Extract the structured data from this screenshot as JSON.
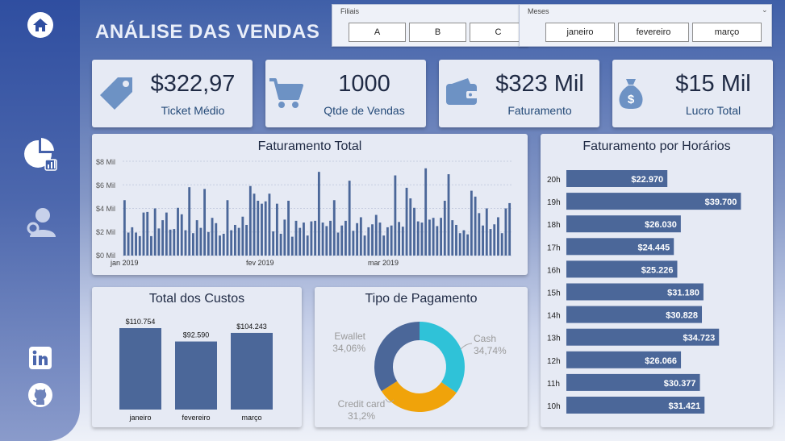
{
  "title": "ANÁLISE DAS VENDAS",
  "colors": {
    "bar": "#4b6799",
    "cash": "#2fc2d8",
    "credit": "#f0a30a",
    "ewallet": "#4b6799"
  },
  "filters": {
    "filiais": {
      "label": "Filiais",
      "options": [
        "A",
        "B",
        "C"
      ]
    },
    "meses": {
      "label": "Meses",
      "options": [
        "janeiro",
        "fevereiro",
        "março"
      ]
    }
  },
  "kpis": [
    {
      "value": "$322,97",
      "label": "Ticket Médio",
      "icon": "price-tag-icon"
    },
    {
      "value": "1000",
      "label": "Qtde de Vendas",
      "icon": "shopping-cart-icon"
    },
    {
      "value": "$323 Mil",
      "label": "Faturamento",
      "icon": "wallet-icon"
    },
    {
      "value": "$15 Mil",
      "label": "Lucro Total",
      "icon": "money-bag-icon"
    }
  ],
  "sidebar": {
    "icons": [
      "home-icon",
      "dashboard-icon",
      "user-search-icon",
      "linkedin-icon",
      "github-icon"
    ]
  },
  "faturamento_total": {
    "title": "Faturamento Total",
    "y_ticks": [
      "$0 Mil",
      "$2 Mil",
      "$4 Mil",
      "$6 Mil",
      "$8 Mil"
    ],
    "x_ticks": [
      "jan 2019",
      "fev 2019",
      "mar 2019"
    ]
  },
  "faturamento_horarios": {
    "title": "Faturamento por Horários",
    "rows": [
      {
        "hour": "20h",
        "label": "$22.970"
      },
      {
        "hour": "19h",
        "label": "$39.700"
      },
      {
        "hour": "18h",
        "label": "$26.030"
      },
      {
        "hour": "17h",
        "label": "$24.445"
      },
      {
        "hour": "16h",
        "label": "$25.226"
      },
      {
        "hour": "15h",
        "label": "$31.180"
      },
      {
        "hour": "14h",
        "label": "$30.828"
      },
      {
        "hour": "13h",
        "label": "$34.723"
      },
      {
        "hour": "12h",
        "label": "$26.066"
      },
      {
        "hour": "11h",
        "label": "$30.377"
      },
      {
        "hour": "10h",
        "label": "$31.421"
      }
    ]
  },
  "total_custos": {
    "title": "Total dos Custos",
    "bars": [
      {
        "month": "janeiro",
        "label": "$110.754"
      },
      {
        "month": "fevereiro",
        "label": "$92.590"
      },
      {
        "month": "março",
        "label": "$104.243"
      }
    ]
  },
  "tipo_pagamento": {
    "title": "Tipo de Pagamento",
    "slices": [
      {
        "name": "Cash",
        "pct_label": "34,74%"
      },
      {
        "name": "Credit card",
        "pct_label": "31,2%"
      },
      {
        "name": "Ewallet",
        "pct_label": "34,06%"
      }
    ]
  },
  "chart_data": [
    {
      "type": "bar",
      "title": "Faturamento Total",
      "xlabel": "",
      "ylabel": "",
      "ylim": [
        0,
        8000
      ],
      "x_range": [
        "2019-01-01",
        "2019-03-30"
      ],
      "values": [
        4700,
        1950,
        2400,
        1950,
        1650,
        3650,
        3700,
        1650,
        4000,
        2300,
        3000,
        3650,
        2200,
        2250,
        4050,
        3500,
        2150,
        5800,
        1900,
        3000,
        2350,
        5650,
        2000,
        3200,
        2750,
        1700,
        1850,
        4700,
        2150,
        2600,
        2350,
        3300,
        2600,
        5900,
        5250,
        4650,
        4400,
        4600,
        5250,
        2050,
        4400,
        1850,
        3050,
        4650,
        1600,
        2950,
        2350,
        2800,
        1700,
        2900,
        2950,
        7100,
        2800,
        2500,
        2950,
        4700,
        1950,
        2550,
        2950,
        6350,
        2100,
        2750,
        3250,
        1700,
        2400,
        2650,
        3450,
        2800,
        1700,
        2400,
        2550,
        6800,
        2850,
        2450,
        5750,
        4850,
        4050,
        2900,
        2800,
        7400,
        3050,
        3200,
        2500,
        3200,
        4650,
        6900,
        3000,
        2600,
        1900,
        2150,
        1800,
        5500,
        5000,
        3600,
        2550,
        4000,
        2250,
        2650,
        3250,
        1900,
        4000,
        4450
      ]
    },
    {
      "type": "bar",
      "title": "Faturamento por Horários",
      "categories": [
        "20h",
        "19h",
        "18h",
        "17h",
        "16h",
        "15h",
        "14h",
        "13h",
        "12h",
        "11h",
        "10h"
      ],
      "values": [
        22970,
        39700,
        26030,
        24445,
        25226,
        31180,
        30828,
        34723,
        26066,
        30377,
        31421
      ]
    },
    {
      "type": "bar",
      "title": "Total dos Custos",
      "categories": [
        "janeiro",
        "fevereiro",
        "março"
      ],
      "values": [
        110754,
        92590,
        104243
      ]
    },
    {
      "type": "pie",
      "title": "Tipo de Pagamento",
      "categories": [
        "Cash",
        "Credit card",
        "Ewallet"
      ],
      "values": [
        34.74,
        31.2,
        34.06
      ]
    }
  ]
}
